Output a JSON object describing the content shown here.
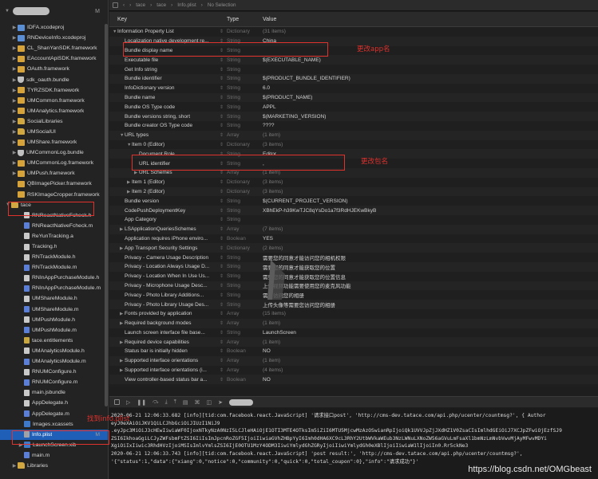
{
  "navigator": {
    "project_status": "M",
    "items": [
      {
        "label": "IDFA.xcodeproj",
        "icon": "xcodeproj-icon",
        "depth": 1,
        "tri": "▶",
        "status": ""
      },
      {
        "label": "RNDeviceInfo.xcodeproj",
        "icon": "xcodeproj-icon",
        "depth": 1,
        "tri": "▶",
        "status": ""
      },
      {
        "label": "CL_ShanYanSDK.framework",
        "icon": "framework-icon",
        "depth": 1,
        "tri": "▶",
        "status": ""
      },
      {
        "label": "EAccountApiSDK.framework",
        "icon": "framework-icon",
        "depth": 1,
        "tri": "▶",
        "status": ""
      },
      {
        "label": "OAuth.framework",
        "icon": "framework-icon",
        "depth": 1,
        "tri": "▶",
        "status": ""
      },
      {
        "label": "sdk_oauth.bundle",
        "icon": "bundle-icon",
        "depth": 1,
        "tri": "▶",
        "status": ""
      },
      {
        "label": "TYRZSDK.framework",
        "icon": "framework-icon",
        "depth": 1,
        "tri": "▶",
        "status": ""
      },
      {
        "label": "UMCommon.framework",
        "icon": "framework-icon",
        "depth": 1,
        "tri": "▶",
        "status": ""
      },
      {
        "label": "UMAnalytics.framework",
        "icon": "framework-icon",
        "depth": 1,
        "tri": "▶",
        "status": ""
      },
      {
        "label": "SocialLibraries",
        "icon": "folder-icon",
        "depth": 1,
        "tri": "▶",
        "status": ""
      },
      {
        "label": "UMSocialUI",
        "icon": "folder-icon",
        "depth": 1,
        "tri": "▶",
        "status": ""
      },
      {
        "label": "UMShare.framework",
        "icon": "framework-icon",
        "depth": 1,
        "tri": "▶",
        "status": ""
      },
      {
        "label": "UMCommonLog.bundle",
        "icon": "bundle-icon",
        "depth": 1,
        "tri": "▶",
        "status": ""
      },
      {
        "label": "UMCommonLog.framework",
        "icon": "framework-icon",
        "depth": 1,
        "tri": "▶",
        "status": ""
      },
      {
        "label": "UMPush.framework",
        "icon": "framework-icon",
        "depth": 1,
        "tri": "▶",
        "status": ""
      },
      {
        "label": "QBImagePicker.framework",
        "icon": "framework-icon",
        "depth": 1,
        "tri": "",
        "status": ""
      },
      {
        "label": "RSKImageCropper.framework",
        "icon": "framework-icon",
        "depth": 1,
        "tri": "",
        "status": ""
      },
      {
        "label": "tace",
        "icon": "folder-icon",
        "depth": 0,
        "tri": "▼",
        "status": ""
      },
      {
        "label": "RNReactNativeFcheck.h",
        "icon": "h-file-icon",
        "depth": 2,
        "tri": "",
        "status": ""
      },
      {
        "label": "RNReactNativeFcheck.m",
        "icon": "m-file-icon",
        "depth": 2,
        "tri": "",
        "status": ""
      },
      {
        "label": "ReYunTracking.a",
        "icon": "lib-file-icon",
        "depth": 2,
        "tri": "",
        "status": ""
      },
      {
        "label": "Tracking.h",
        "icon": "h-file-icon",
        "depth": 2,
        "tri": "",
        "status": ""
      },
      {
        "label": "RNTrackModule.h",
        "icon": "h-file-icon",
        "depth": 2,
        "tri": "",
        "status": ""
      },
      {
        "label": "RNTrackModule.m",
        "icon": "m-file-icon",
        "depth": 2,
        "tri": "",
        "status": ""
      },
      {
        "label": "RNInAppPurchaseModule.h",
        "icon": "h-file-icon",
        "depth": 2,
        "tri": "",
        "status": ""
      },
      {
        "label": "RNInAppPurchaseModule.m",
        "icon": "m-file-icon",
        "depth": 2,
        "tri": "",
        "status": ""
      },
      {
        "label": "UMShareModule.h",
        "icon": "h-file-icon",
        "depth": 2,
        "tri": "",
        "status": ""
      },
      {
        "label": "UMShareModule.m",
        "icon": "m-file-icon",
        "depth": 2,
        "tri": "",
        "status": ""
      },
      {
        "label": "UMPushModule.h",
        "icon": "h-file-icon",
        "depth": 2,
        "tri": "",
        "status": ""
      },
      {
        "label": "UMPushModule.m",
        "icon": "m-file-icon",
        "depth": 2,
        "tri": "",
        "status": ""
      },
      {
        "label": "tace.entitlements",
        "icon": "entitlements-icon",
        "depth": 2,
        "tri": "",
        "status": ""
      },
      {
        "label": "UMAnalyticsModule.h",
        "icon": "h-file-icon",
        "depth": 2,
        "tri": "",
        "status": ""
      },
      {
        "label": "UMAnalyticsModule.m",
        "icon": "m-file-icon",
        "depth": 2,
        "tri": "",
        "status": ""
      },
      {
        "label": "RNUMConfigure.h",
        "icon": "h-file-icon",
        "depth": 2,
        "tri": "",
        "status": ""
      },
      {
        "label": "RNUMConfigure.m",
        "icon": "m-file-icon",
        "depth": 2,
        "tri": "",
        "status": ""
      },
      {
        "label": "main.jsbundle",
        "icon": "file-icon",
        "depth": 2,
        "tri": "",
        "status": ""
      },
      {
        "label": "AppDelegate.h",
        "icon": "h-file-icon",
        "depth": 2,
        "tri": "",
        "status": ""
      },
      {
        "label": "AppDelegate.m",
        "icon": "m-file-icon",
        "depth": 2,
        "tri": "",
        "status": ""
      },
      {
        "label": "Images.xcassets",
        "icon": "asset-catalog-icon",
        "depth": 2,
        "tri": "",
        "status": ""
      },
      {
        "label": "Info.plist",
        "icon": "plist-file-icon",
        "depth": 2,
        "tri": "",
        "status": "M",
        "selected": true
      },
      {
        "label": "LaunchScreen.xib",
        "icon": "xib-file-icon",
        "depth": 2,
        "tri": "▶",
        "status": ""
      },
      {
        "label": "main.m",
        "icon": "m-file-icon",
        "depth": 2,
        "tri": "",
        "status": ""
      },
      {
        "label": "Libraries",
        "icon": "folder-icon",
        "depth": 1,
        "tri": "▶",
        "status": ""
      }
    ]
  },
  "editor": {
    "breadcrumb": [
      "tace",
      "tace",
      "Info.plist",
      "No Selection"
    ],
    "columns": {
      "key": "Key",
      "type": "Type",
      "value": "Value"
    }
  },
  "plist_rows": [
    {
      "key": "Information Property List",
      "type": "Dictionary",
      "value": "(31 items)",
      "depth": 0,
      "tri": "▼",
      "dim": true
    },
    {
      "key": "Localization native development re...",
      "type": "String",
      "value": "China",
      "depth": 1,
      "tri": ""
    },
    {
      "key": "Bundle display name",
      "type": "String",
      "value": "",
      "depth": 1,
      "tri": ""
    },
    {
      "key": "Executable file",
      "type": "String",
      "value": "$(EXECUTABLE_NAME)",
      "depth": 1,
      "tri": ""
    },
    {
      "key": "Get Info string",
      "type": "String",
      "value": "",
      "depth": 1,
      "tri": ""
    },
    {
      "key": "Bundle identifier",
      "type": "String",
      "value": "$(PRODUCT_BUNDLE_IDENTIFIER)",
      "depth": 1,
      "tri": ""
    },
    {
      "key": "InfoDictionary version",
      "type": "String",
      "value": "6.0",
      "depth": 1,
      "tri": ""
    },
    {
      "key": "Bundle name",
      "type": "String",
      "value": "$(PRODUCT_NAME)",
      "depth": 1,
      "tri": ""
    },
    {
      "key": "Bundle OS Type code",
      "type": "String",
      "value": "APPL",
      "depth": 1,
      "tri": ""
    },
    {
      "key": "Bundle versions string, short",
      "type": "String",
      "value": "$(MARKETING_VERSION)",
      "depth": 1,
      "tri": ""
    },
    {
      "key": "Bundle creator OS Type code",
      "type": "String",
      "value": "????",
      "depth": 1,
      "tri": ""
    },
    {
      "key": "URL types",
      "type": "Array",
      "value": "(1 item)",
      "depth": 1,
      "tri": "▼",
      "dim": true
    },
    {
      "key": "Item 0 (Editor)",
      "type": "Dictionary",
      "value": "(3 items)",
      "depth": 2,
      "tri": "▼",
      "dim": true
    },
    {
      "key": "Document Role",
      "type": "String",
      "value": "Editor",
      "depth": 3,
      "tri": ""
    },
    {
      "key": "URL identifier",
      "type": "String",
      "value": ",",
      "depth": 3,
      "tri": ""
    },
    {
      "key": "URL Schemes",
      "type": "Array",
      "value": "(1 item)",
      "depth": 3,
      "tri": "▶",
      "dim": true
    },
    {
      "key": "Item 1 (Editor)",
      "type": "Dictionary",
      "value": "(3 items)",
      "depth": 2,
      "tri": "▶",
      "dim": true
    },
    {
      "key": "Item 2 (Editor)",
      "type": "Dictionary",
      "value": "(3 items)",
      "depth": 2,
      "tri": "▶",
      "dim": true
    },
    {
      "key": "Bundle version",
      "type": "String",
      "value": "$(CURRENT_PROJECT_VERSION)",
      "depth": 1,
      "tri": ""
    },
    {
      "key": "CodePushDeploymentKey",
      "type": "String",
      "value": "XBhEkP-h39KwTJC8qYsDo1a7f3RdHJEKwBkyB",
      "depth": 1,
      "tri": ""
    },
    {
      "key": "App Category",
      "type": "String",
      "value": "",
      "depth": 1,
      "tri": ""
    },
    {
      "key": "LSApplicationQueriesSchemes",
      "type": "Array",
      "value": "(7 items)",
      "depth": 1,
      "tri": "▶",
      "dim": true
    },
    {
      "key": "Application requires iPhone enviro...",
      "type": "Boolean",
      "value": "YES",
      "depth": 1,
      "tri": ""
    },
    {
      "key": "App Transport Security Settings",
      "type": "Dictionary",
      "value": "(2 items)",
      "depth": 1,
      "tri": "▶",
      "dim": true
    },
    {
      "key": "Privacy - Camera Usage Description",
      "type": "String",
      "value": "需要您的同意才能访问您的相机权限",
      "depth": 1,
      "tri": ""
    },
    {
      "key": "Privacy - Location Always Usage D...",
      "type": "String",
      "value": "需要您的同意才能获取您的位置",
      "depth": 1,
      "tri": ""
    },
    {
      "key": "Privacy - Location When In Use Us...",
      "type": "String",
      "value": "需要您的同意才能获取您的位置信息",
      "depth": 1,
      "tri": ""
    },
    {
      "key": "Privacy - Microphone Usage Desc...",
      "type": "String",
      "value": "上传视频功能需要使用您的麦克风功能",
      "depth": 1,
      "tri": ""
    },
    {
      "key": "Privacy - Photo Library Additions...",
      "type": "String",
      "value": "需要访问您的相册",
      "depth": 1,
      "tri": ""
    },
    {
      "key": "Privacy - Photo Library Usage Des...",
      "type": "String",
      "value": "上传头像等需要您访问您的相册",
      "depth": 1,
      "tri": ""
    },
    {
      "key": "Fonts provided by application",
      "type": "Array",
      "value": "(15 items)",
      "depth": 1,
      "tri": "▶",
      "dim": true
    },
    {
      "key": "Required background modes",
      "type": "Array",
      "value": "(1 item)",
      "depth": 1,
      "tri": "▶",
      "dim": true
    },
    {
      "key": "Launch screen interface file base...",
      "type": "String",
      "value": "LaunchScreen",
      "depth": 1,
      "tri": ""
    },
    {
      "key": "Required device capabilities",
      "type": "Array",
      "value": "(1 item)",
      "depth": 1,
      "tri": "▶",
      "dim": true
    },
    {
      "key": "Status bar is initially hidden",
      "type": "Boolean",
      "value": "NO",
      "depth": 1,
      "tri": ""
    },
    {
      "key": "Supported interface orientations",
      "type": "Array",
      "value": "(1 item)",
      "depth": 1,
      "tri": "▶",
      "dim": true
    },
    {
      "key": "Supported interface orientations (i...",
      "type": "Array",
      "value": "(4 items)",
      "depth": 1,
      "tri": "▶",
      "dim": true
    },
    {
      "key": "View controller-based status bar a...",
      "type": "Boolean",
      "value": "NO",
      "depth": 1,
      "tri": ""
    }
  ],
  "console_lines": [
    "2020-06-21 12:06:33.682 [info][tid:com.facebook.react.JavaScript] '请求接口post', 'http://cms-dev.tatace.com/api.php/ucenter/countmsg?', { Author",
    "  eyJ0eXAiOiJKV1QiLCJhbGciOiJIUzI1NiJ9",
    "  .eyJpc3MiOiJ3cHEwIiwiaWF0IjoxNTkyNzA0NzI5LCJleHAiOjE1OTI3MTE4OTksIm5iZiI6MTU5MjcwMzAzOSwianRpIjoiQk1UVVJpZjJXdHZ1V0ZsaCIsImlhdGEiOiJ7XCJpZFwiOjEzfSJ9",
    "  ZSI6IkhoaGgiLCJyZWFsbmFtZSI6IiIsImJpcnRoZGF5IjoiIiwiaGVhZHBpYyI6Imh0dHA6XC9cL3RhY2UtbWVkaWEub3NzLWNuLXNoZW56aGVuLmFsaXl1bmNzLmNvbVwvMjAyMFwvMDYi",
    "  XgiOiIxIiwic3RhdHVzIjoiMSIsImlvYmlsZSI6IjE0OTU1MzY4ODM3IiwiYmlydGhZGRyIjoiIiwiYmlydGh0eXBlIjoiIiwiaW1lIjoiIn0.Rr5ckNe3",
    "2020-06-21 12:06:33.743 [info][tid:com.facebook.react.JavaScript] 'post result:', 'http://cms-dev.tatace.com/api.php/ucenter/countmsg?',",
    "  '{\"status\":1,\"data\":{\"xiang\":0,\"notice\":0,\"community\":0,\"quick\":0,\"total_coupon\":0},\"info\":\"请求成功\"}'"
  ],
  "annotations": {
    "change_app_name": "更改app名",
    "change_bundle_id": "更改包名",
    "find_info_plist": "找到info.plist"
  },
  "watermark": "https://blog.csdn.net/OMGbeast"
}
